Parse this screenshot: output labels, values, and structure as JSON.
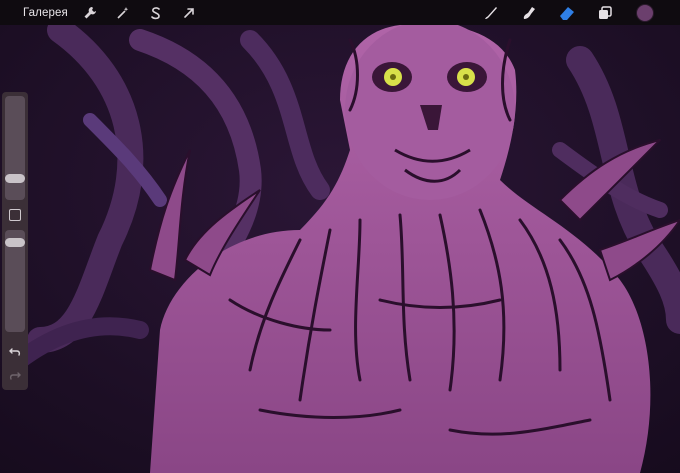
{
  "toolbar": {
    "gallery_label": "Галерея",
    "actions_icon": "wrench-icon",
    "adjustments_icon": "magic-wand-icon",
    "selection_icon": "selection-s-icon",
    "transform_icon": "arrow-cursor-icon",
    "brush_icon": "brush-icon",
    "smudge_icon": "smudge-icon",
    "eraser_icon": "eraser-icon",
    "layers_icon": "layers-icon",
    "active_color": "#6b3f6d",
    "active_tool_color": "#2f7fe6"
  },
  "sidebar": {
    "brush_size_level": 0.55,
    "opacity_level": 0.95
  },
  "colors": {
    "background": "#1c0f24",
    "figure": "#a05a9b",
    "eyes": "#d8e04a",
    "lines": "#2a0f2c"
  }
}
